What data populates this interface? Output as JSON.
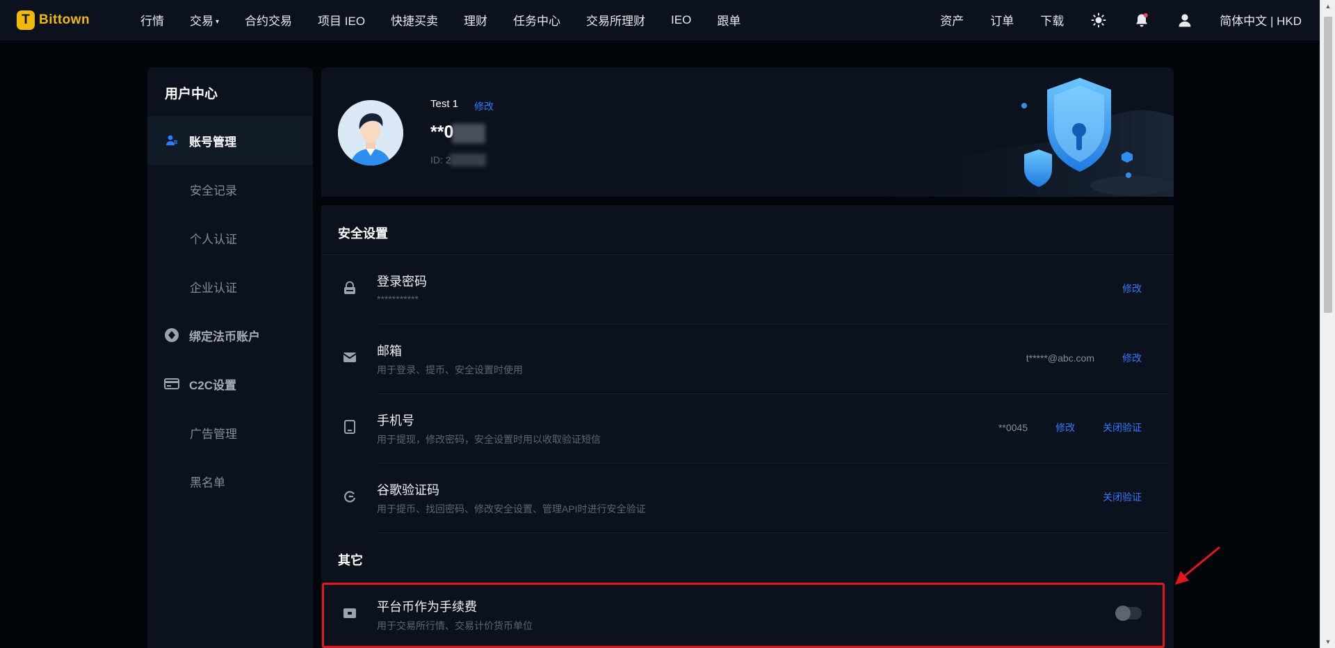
{
  "brand": {
    "logo_glyph": "T",
    "name": "Bittown",
    "color": "#f0b90b"
  },
  "nav": {
    "items": [
      "行情",
      "交易",
      "合约交易",
      "项目 IEO",
      "快捷买卖",
      "理财",
      "任务中心",
      "交易所理财",
      "IEO",
      "跟单"
    ],
    "dropdown_marker": "▾",
    "right": {
      "assets": "资产",
      "orders": "订单",
      "download": "下载",
      "language": "简体中文 | HKD"
    },
    "icons": [
      "theme-sun-icon",
      "notification-bell-icon",
      "user-account-icon"
    ]
  },
  "sidebar": {
    "title": "用户中心",
    "items": [
      {
        "label": "账号管理",
        "active": true,
        "icon": "account-user-icon"
      },
      {
        "label": "安全记录"
      },
      {
        "label": "个人认证"
      },
      {
        "label": "企业认证"
      },
      {
        "label": "绑定法币账户",
        "icon": "fiat-account-icon"
      },
      {
        "label": "C2C设置",
        "icon": "c2c-card-icon"
      },
      {
        "label": "广告管理"
      },
      {
        "label": "黑名单"
      }
    ]
  },
  "profile": {
    "nickname": "Test 1",
    "edit_label": "修改",
    "account_masked": "**0",
    "id_label": "ID: 2"
  },
  "security": {
    "title": "安全设置",
    "rows": [
      {
        "title": "登录密码",
        "desc": "***********",
        "icon": "lock-icon",
        "links": [
          "修改"
        ]
      },
      {
        "title": "邮箱",
        "desc": "用于登录、提币、安全设置时使用",
        "icon": "mail-icon",
        "value": "t*****@abc.com",
        "links": [
          "修改"
        ]
      },
      {
        "title": "手机号",
        "desc": "用于提现，修改密码，安全设置时用以收取验证短信",
        "icon": "phone-icon",
        "value": "**0045",
        "links": [
          "修改",
          "关闭验证"
        ]
      },
      {
        "title": "谷歌验证码",
        "desc": "用于提币、找回密码、修改安全设置、管理API时进行安全验证",
        "icon": "google-auth-icon",
        "links": [
          "关闭验证"
        ]
      }
    ]
  },
  "other": {
    "title": "其它",
    "rows": [
      {
        "title": "平台币作为手续费",
        "desc": "用于交易所行情、交易计价货币单位",
        "icon": "fee-coin-icon",
        "toggle_on": false
      }
    ]
  },
  "colors": {
    "accent_link": "#2f7bff",
    "highlight_border": "#e5161c",
    "panel_bg": "#0b121d"
  }
}
